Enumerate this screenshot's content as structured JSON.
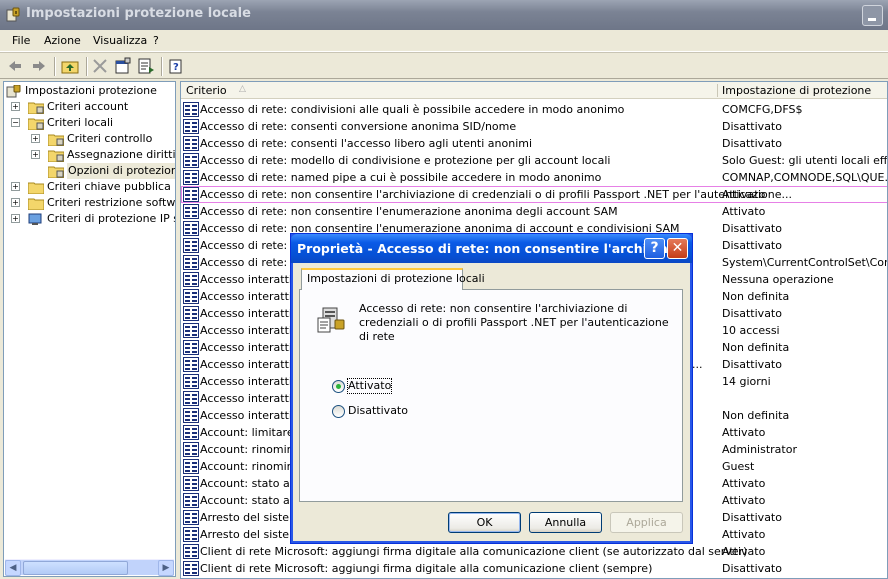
{
  "window": {
    "title": "Impostazioni protezione locale"
  },
  "menu": [
    "File",
    "Azione",
    "Visualizza",
    "?"
  ],
  "tree": {
    "items": [
      {
        "label": "Impostazioni protezione",
        "level": 0,
        "expander": ""
      },
      {
        "label": "Criteri account",
        "level": 1,
        "expander": "+"
      },
      {
        "label": "Criteri locali",
        "level": 1,
        "expander": "−"
      },
      {
        "label": "Criteri controllo",
        "level": 2,
        "expander": "+"
      },
      {
        "label": "Assegnazione diritti utente",
        "level": 2,
        "expander": "+"
      },
      {
        "label": "Opzioni di protezione",
        "level": 2,
        "expander": ""
      },
      {
        "label": "Criteri chiave pubblica",
        "level": 1,
        "expander": "+"
      },
      {
        "label": "Criteri restrizione software",
        "level": 1,
        "expander": "+"
      },
      {
        "label": "Criteri di protezione IP su computer locale",
        "level": 1,
        "expander": "+"
      }
    ]
  },
  "list": {
    "columns": {
      "policy": "Criterio",
      "setting": "Impostazione di protezione"
    },
    "rows": [
      {
        "policy": "Accesso di rete: condivisioni alle quali è possibile accedere in modo anonimo",
        "setting": "COMCFG,DFS$"
      },
      {
        "policy": "Accesso di rete: consenti conversione anonima SID/nome",
        "setting": "Disattivato"
      },
      {
        "policy": "Accesso di rete: consenti l'accesso libero agli utenti anonimi",
        "setting": "Disattivato"
      },
      {
        "policy": "Accesso di rete: modello di condivisione e protezione per gli account locali",
        "setting": "Solo Guest: gli utenti locali effe..."
      },
      {
        "policy": "Accesso di rete: named pipe a cui è possibile accedere in modo anonimo",
        "setting": "COMNAP,COMNODE,SQL\\QUE..."
      },
      {
        "policy": "Accesso di rete: non consentire l'archiviazione di credenziali o di profili Passport .NET per l'autenticazione...",
        "setting": "Attivato"
      },
      {
        "policy": "Accesso di rete: non consentire l'enumerazione anonima degli account SAM",
        "setting": "Attivato"
      },
      {
        "policy": "Accesso di rete: non consentire l'enumerazione anonima di account e condivisioni SAM",
        "setting": "Disattivato"
      },
      {
        "policy": "Accesso di rete: non",
        "setting": "Disattivato"
      },
      {
        "policy": "Accesso di rete: pe",
        "setting": "System\\CurrentControlSet\\Con..."
      },
      {
        "policy": "Accesso interattivo",
        "setting": "Nessuna operazione"
      },
      {
        "policy": "Accesso interattivo",
        "setting": "Non definita"
      },
      {
        "policy": "Accesso interattivo",
        "setting": "Disattivato"
      },
      {
        "policy": "Accesso interattivo",
        "setting": "10 accessi"
      },
      {
        "policy": "Accesso interattivo",
        "setting": "Non definita"
      },
      {
        "policy": "Accesso interattivo",
        "setting": "Disattivato"
      },
      {
        "policy": "Accesso interattivo",
        "setting": "14 giorni"
      },
      {
        "policy": "Accesso interattivo",
        "setting": ""
      },
      {
        "policy": "Accesso interattivo",
        "setting": "Non definita"
      },
      {
        "policy": "Account: limitare l'u",
        "setting": "Attivato"
      },
      {
        "policy": "Account: rinomina",
        "setting": "Administrator"
      },
      {
        "policy": "Account: rinomina",
        "setting": "Guest"
      },
      {
        "policy": "Account: stato acc",
        "setting": "Attivato"
      },
      {
        "policy": "Account: stato acc",
        "setting": "Attivato"
      },
      {
        "policy": "Arresto del sistema",
        "setting": "Disattivato"
      },
      {
        "policy": "Arresto del sistema",
        "setting": "Attivato"
      },
      {
        "policy": "Client di rete Microsoft: aggiungi firma digitale alla comunicazione client (se autorizzato dal server)",
        "setting": "Attivato"
      },
      {
        "policy": "Client di rete Microsoft: aggiungi firma digitale alla comunicazione client (sempre)",
        "setting": "Disattivato"
      }
    ],
    "overflow_fragments": [
      "er",
      "at..."
    ]
  },
  "dialog": {
    "title": "Proprietà - Accesso di rete: non consentire l'archivia...",
    "help": "?",
    "close": "✕",
    "tab": "Impostazioni di protezione locali",
    "description": "Accesso di rete: non consentire l'archiviazione di credenziali o di profili Passport .NET per l'autenticazione di rete",
    "options": {
      "enabled": "Attivato",
      "disabled": "Disattivato"
    },
    "buttons": {
      "ok": "OK",
      "cancel": "Annulla",
      "apply": "Applica"
    }
  },
  "colors": {
    "selection_outline": "#e680e6",
    "dialog_title": "#0a5ae6",
    "radio_dot": "#2bb33b"
  }
}
